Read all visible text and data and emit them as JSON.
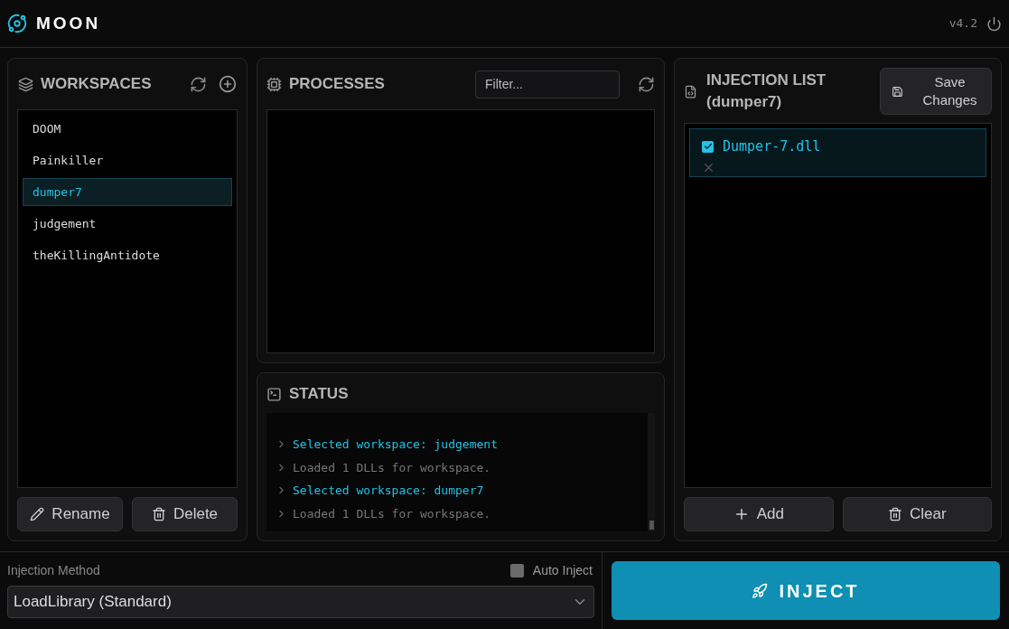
{
  "app": {
    "title": "MOON",
    "version": "v4.2"
  },
  "workspaces": {
    "title": "WORKSPACES",
    "items": [
      {
        "label": "DOOM",
        "selected": false
      },
      {
        "label": "Painkiller",
        "selected": false
      },
      {
        "label": "dumper7",
        "selected": true
      },
      {
        "label": "judgement",
        "selected": false
      },
      {
        "label": "theKillingAntidote",
        "selected": false
      }
    ],
    "buttons": [
      "Rename",
      "Delete"
    ]
  },
  "processes": {
    "title": "PROCESSES",
    "filter": {
      "placeholder": "Filter..."
    }
  },
  "status": {
    "title": "STATUS",
    "lines": [
      {
        "kind": "selected",
        "text": "Selected workspace: judgement"
      },
      {
        "kind": "info",
        "text": "Loaded 1 DLLs for workspace."
      },
      {
        "kind": "selected",
        "text": "Selected workspace: dumper7"
      },
      {
        "kind": "info",
        "text": "Loaded 1 DLLs for workspace."
      }
    ]
  },
  "injection_list": {
    "title": "INJECTION LIST",
    "subtitle": "(dumper7)",
    "save_button": "Save Changes",
    "items": [
      {
        "name": "Dumper-7.dll",
        "checked": true
      }
    ],
    "buttons": [
      "Add",
      "Clear"
    ]
  },
  "bottom": {
    "method_label": "Injection Method",
    "method_value": "LoadLibrary (Standard)",
    "auto_inject": {
      "label": "Auto Inject",
      "checked": false
    },
    "inject_button": "INJECT"
  }
}
